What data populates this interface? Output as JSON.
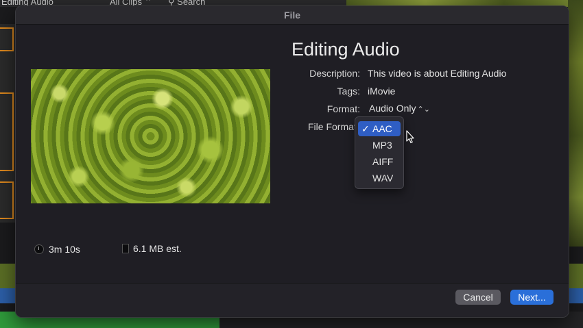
{
  "background": {
    "top_left_text": "Editing Audio",
    "clip_filter": "All Clips",
    "search_placeholder": "Search"
  },
  "dialog": {
    "title": "File",
    "project_title": "Editing Audio",
    "fields": {
      "description_label": "Description:",
      "description_value": "This video is about Editing Audio",
      "tags_label": "Tags:",
      "tags_value": "iMovie",
      "format_label": "Format:",
      "format_value": "Audio Only",
      "file_format_label": "File Format:"
    },
    "file_format_menu": {
      "options": [
        "AAC",
        "MP3",
        "AIFF",
        "WAV"
      ],
      "selected": "AAC",
      "check_glyph": "✓"
    },
    "duration": "3m 10s",
    "size": "6.1 MB est.",
    "buttons": {
      "cancel": "Cancel",
      "next": "Next..."
    }
  },
  "icons": [
    "clock-icon",
    "file-icon",
    "chevron-updown-icon",
    "checkmark-icon",
    "mouse-pointer-icon",
    "search-icon"
  ],
  "colors": {
    "accent": "#2a6fd9",
    "menu_highlight": "#2f5ec4",
    "dialog_bg": "#1f1e24"
  }
}
